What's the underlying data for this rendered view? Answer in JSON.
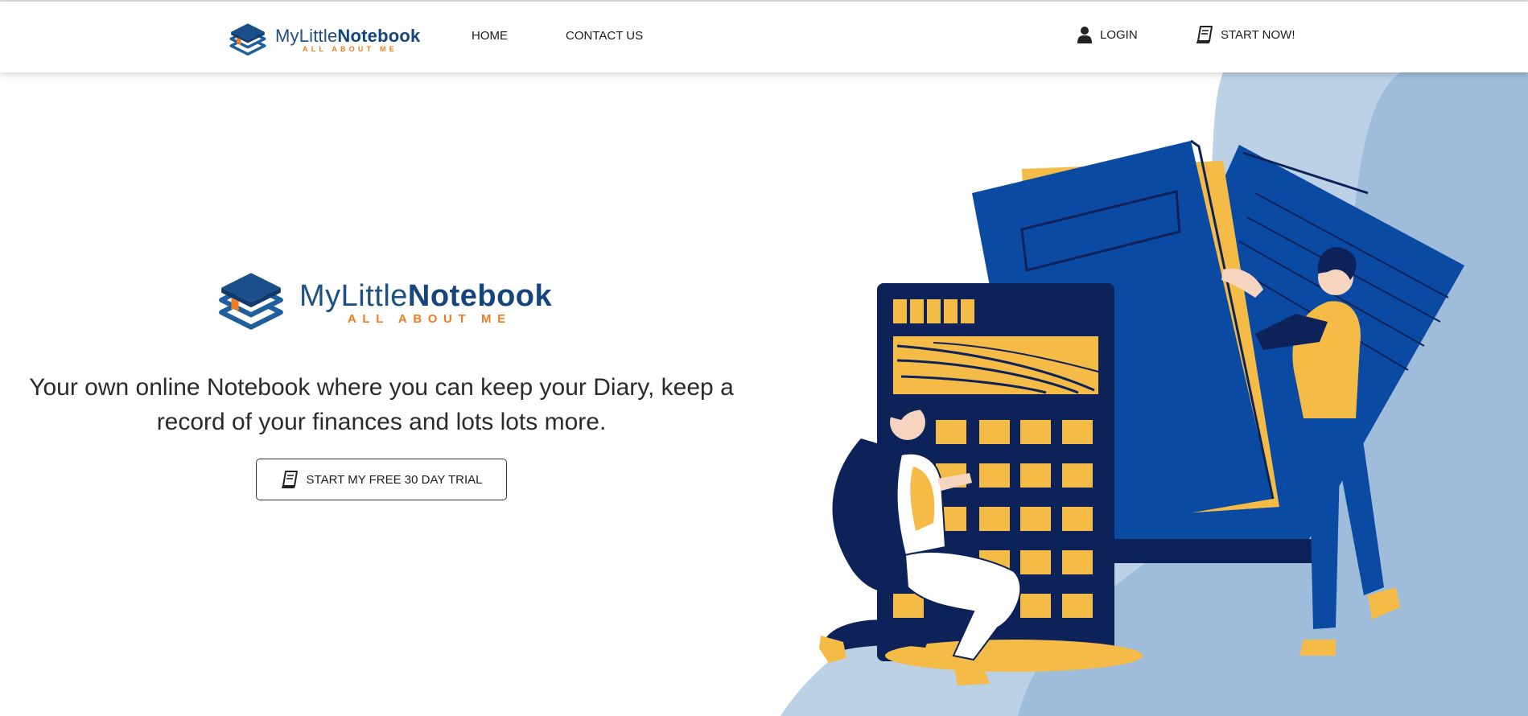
{
  "brand": {
    "name_light": "MyLittle",
    "name_bold": "Notebook",
    "tagline": "ALL ABOUT ME"
  },
  "nav": {
    "home": "HOME",
    "contact": "CONTACT US",
    "login": "LOGIN",
    "start": "START NOW!"
  },
  "hero": {
    "description": "Your own online Notebook where you can keep your Diary, keep a record of your finances and lots lots more.",
    "cta_label": "START MY FREE 30 DAY TRIAL"
  },
  "icons": {
    "logo": "stacked-books-icon",
    "login": "user-icon",
    "start": "notebook-icon",
    "cta": "notebook-icon"
  },
  "colors": {
    "navy": "#0c2259",
    "royal_blue": "#0b4aa2",
    "mustard": "#f4bb47",
    "light_blue": "#bcd0e6",
    "mid_blue": "#9fbcdb",
    "brand_orange": "#f07c1f"
  }
}
